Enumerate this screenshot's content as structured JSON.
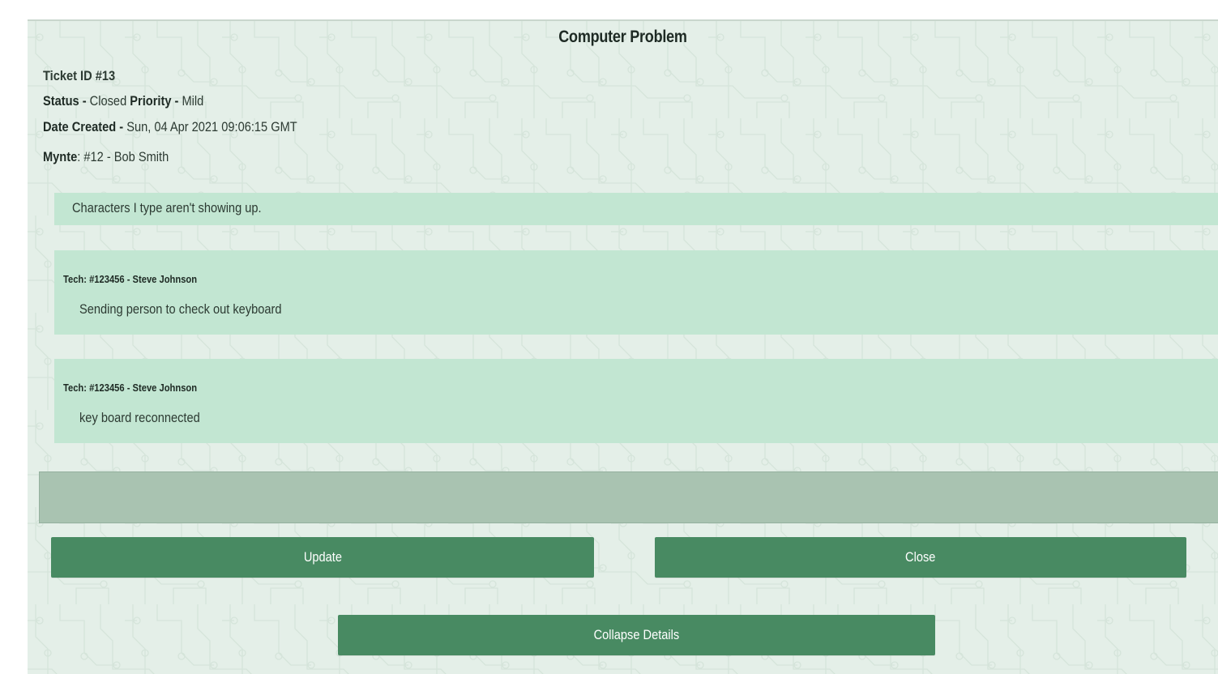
{
  "ticket": {
    "title": "Computer Problem",
    "id_label": "Ticket ID #13",
    "status_label": "Status -",
    "status_value": "Closed",
    "priority_label": "Priority -",
    "priority_value": "Mild",
    "date_label": "Date Created -",
    "date_value": "Sun, 04 Apr 2021 09:06:15 GMT",
    "mynte_label": "Mynte",
    "mynte_value": ": #12 - Bob Smith",
    "description": "Characters I type aren't showing up."
  },
  "notes": [
    {
      "author": "Tech: #123456 - Steve Johnson",
      "text": "Sending person to check out keyboard"
    },
    {
      "author": "Tech: #123456 - Steve Johnson",
      "text": "key board reconnected"
    }
  ],
  "update_field": {
    "value": ""
  },
  "buttons": {
    "update": "Update",
    "close": "Close",
    "collapse": "Collapse Details"
  },
  "colors": {
    "panel_background": "#e4efe8",
    "note_background": "#c2e6d2",
    "button_green": "#488a62",
    "field_background": "#a9c3b1"
  }
}
